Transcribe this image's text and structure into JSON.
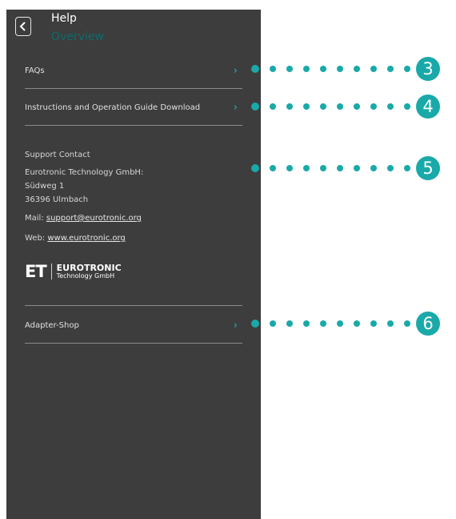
{
  "header": {
    "title": "Help",
    "subtitle": "Overview",
    "back_icon": "chevron-left-icon"
  },
  "menu": {
    "faqs": "FAQs",
    "instructions": "Instructions and Operation Guide Download",
    "adapter_shop": "Adapter-Shop",
    "chevron": "›"
  },
  "contact": {
    "heading": "Support Contact",
    "company": "Eurotronic Technology GmbH:",
    "street": "Südweg 1",
    "city": "36396 Ulmbach",
    "mail_label": "Mail:",
    "mail": "support@eurotronic.org",
    "web_label": "Web:",
    "web": "www.eurotronic.org"
  },
  "logo": {
    "mark": "ET",
    "name": "EUROTRONIC",
    "sub": "Technology GmbH"
  },
  "callouts": [
    "3",
    "4",
    "5",
    "6"
  ],
  "colors": {
    "panel": "#3d3d3d",
    "accent": "#1aa9a9"
  }
}
